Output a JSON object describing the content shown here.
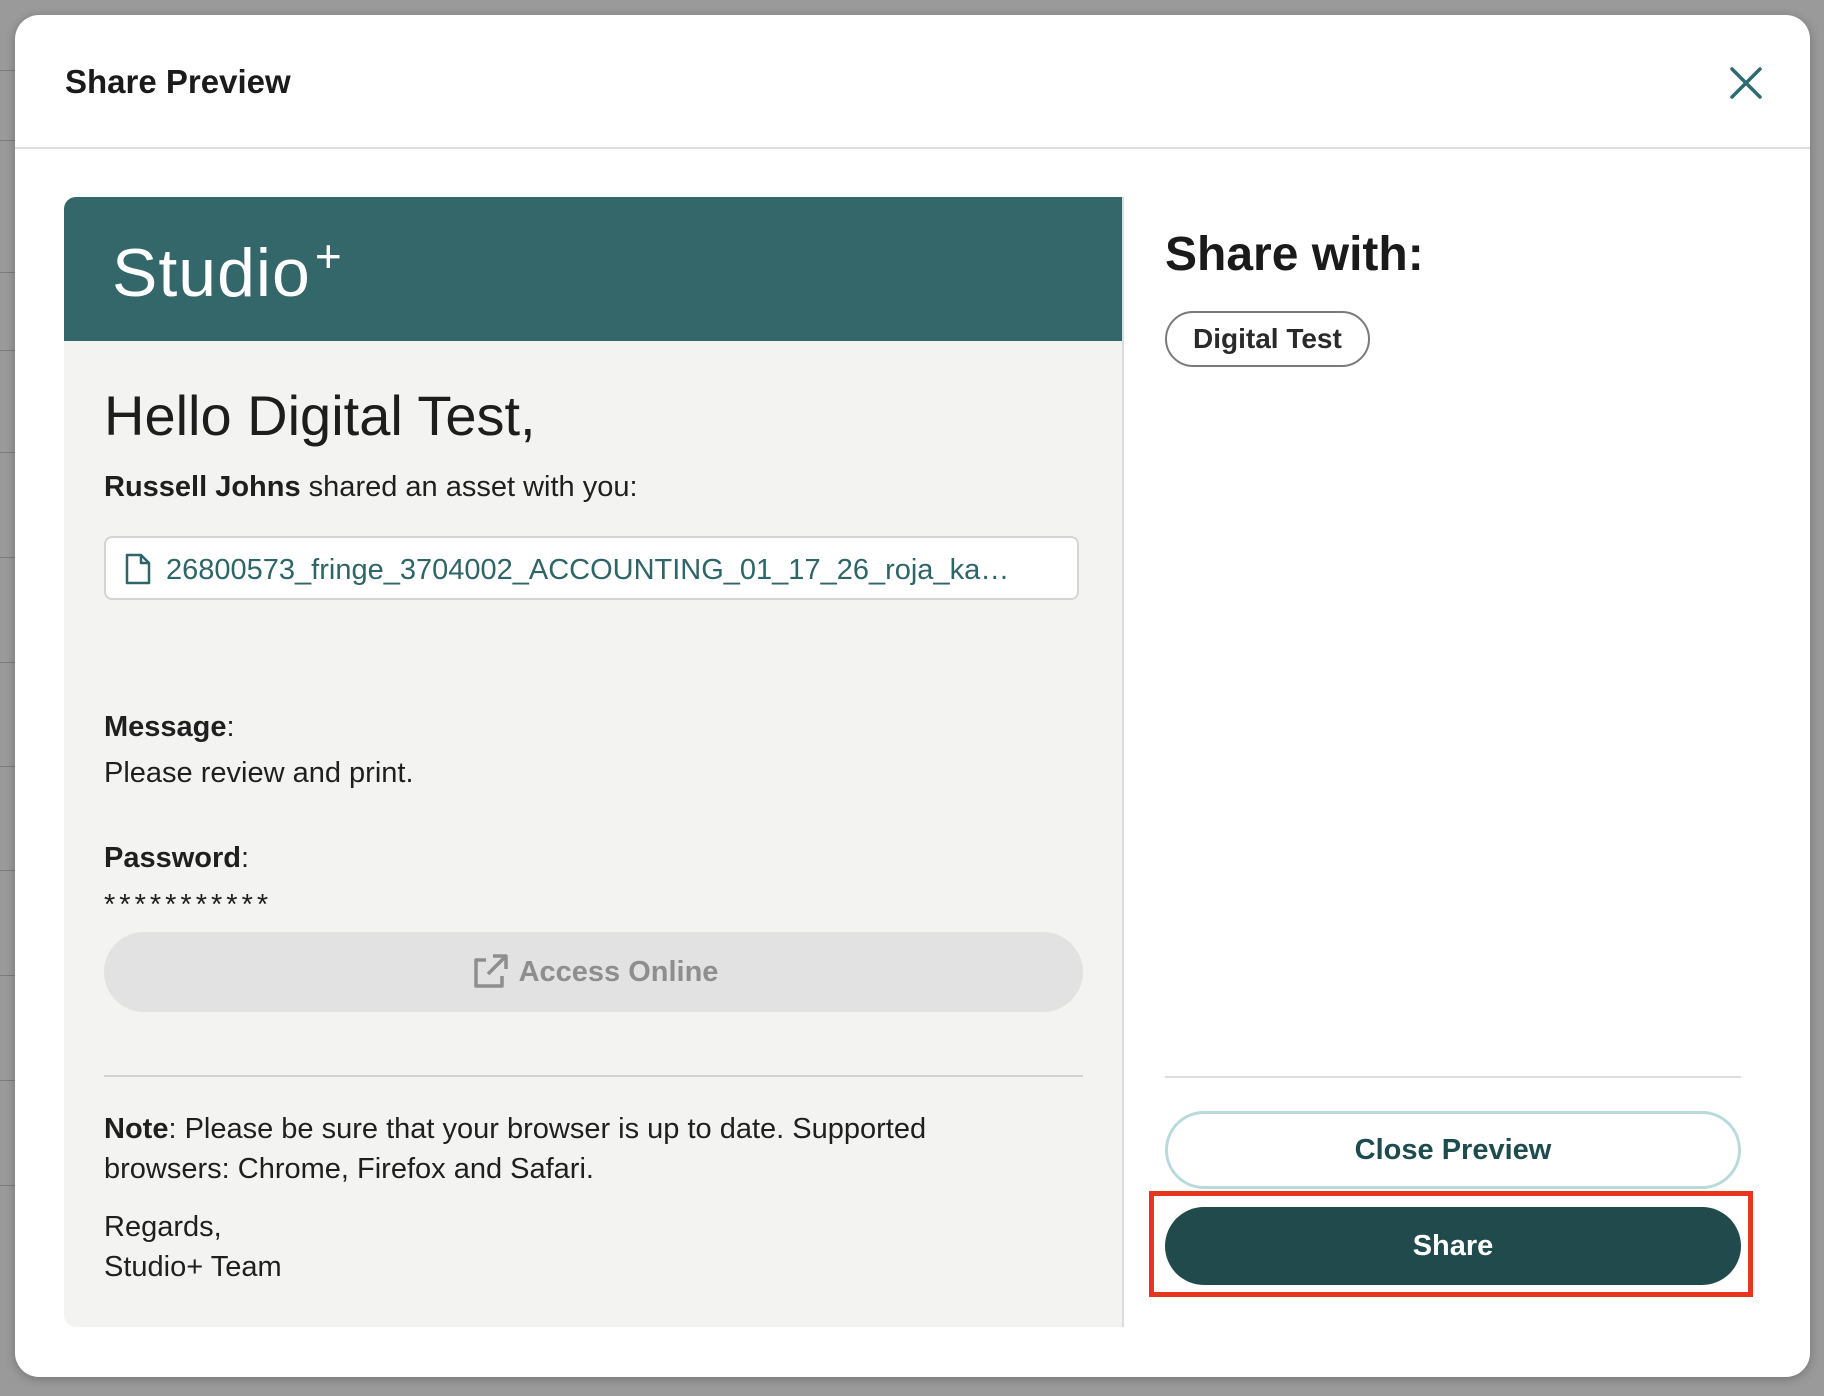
{
  "modal": {
    "title": "Share Preview"
  },
  "preview": {
    "brand": "Studio",
    "brand_suffix": "+",
    "greeting": "Hello Digital Test,",
    "sender_name": "Russell Johns",
    "shared_text": " shared an asset with you:",
    "file_name": "26800573_fringe_3704002_ACCOUNTING_01_17_26_roja_ka…",
    "message_label": "Message",
    "message_value": "Please review and print.",
    "password_label": "Password",
    "password_value": "***********",
    "access_button_label": "Access Online",
    "note_label": "Note",
    "note_text": ": Please be sure that your browser is up to date. Supported browsers: Chrome, Firefox and Safari.",
    "regards_line1": "Regards,",
    "regards_line2": "Studio+ Team"
  },
  "share_panel": {
    "title": "Share with:",
    "recipients": [
      "Digital Test"
    ],
    "close_preview_label": "Close Preview",
    "share_label": "Share"
  },
  "colors": {
    "brand_bar": "#33676a",
    "share_button": "#214a4c",
    "highlight": "#e8351f",
    "file_link": "#2e6567"
  },
  "icons": {
    "close": "close-icon",
    "file": "file-icon",
    "external_link": "external-link-icon"
  }
}
